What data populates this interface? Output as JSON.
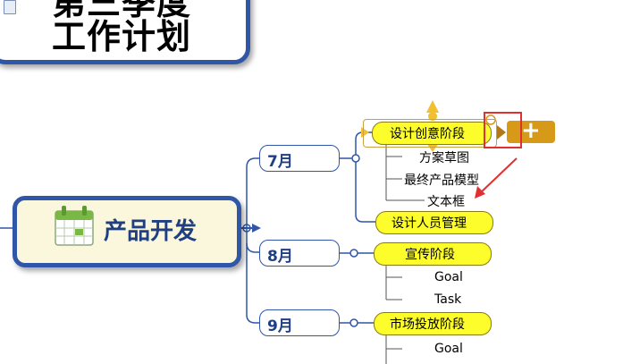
{
  "title": {
    "line1": "第三季度",
    "line2": "工作计划"
  },
  "root": {
    "label": "产品开发",
    "icon": "calendar-icon"
  },
  "months": [
    {
      "label": "7月",
      "phases": [
        {
          "label": "设计创意阶段",
          "children": [
            "方案草图",
            "最终产品模型",
            "文本框"
          ]
        },
        {
          "label": "设计人员管理",
          "children": []
        }
      ]
    },
    {
      "label": "8月",
      "phases": [
        {
          "label": "宣传阶段",
          "children": [
            "Goal",
            "Task"
          ]
        }
      ]
    },
    {
      "label": "9月",
      "phases": [
        {
          "label": "市场投放阶段",
          "children": [
            "Goal"
          ]
        }
      ]
    }
  ],
  "add_button": {
    "glyph": "+"
  },
  "colors": {
    "node_border": "#2f56a7",
    "phase_fill": "#fdfd2c",
    "root_fill": "#fbf7dc",
    "add_tab": "#d69a18",
    "annotation": "#e03030"
  }
}
